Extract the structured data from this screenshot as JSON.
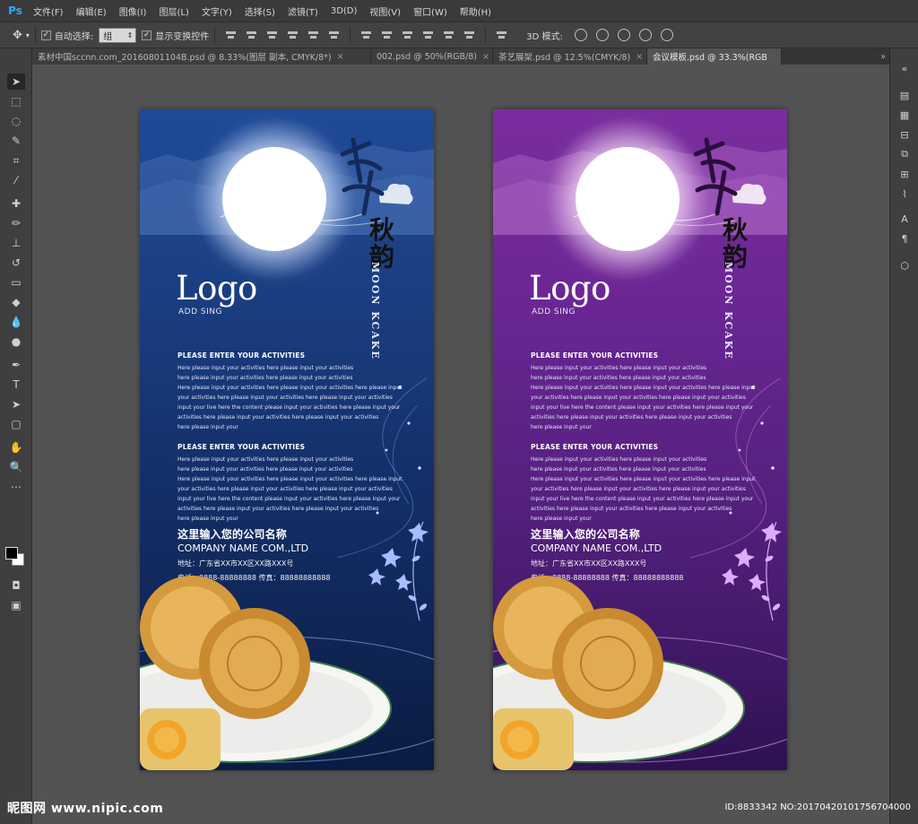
{
  "app": {
    "logo": "Ps"
  },
  "menu": [
    "文件(F)",
    "编辑(E)",
    "图像(I)",
    "图层(L)",
    "文字(Y)",
    "选择(S)",
    "滤镜(T)",
    "3D(D)",
    "视图(V)",
    "窗口(W)",
    "帮助(H)"
  ],
  "options": {
    "auto_select_label": "自动选择:",
    "auto_select_value": "组",
    "show_transform_label": "显示变换控件",
    "mode3d_label": "3D 模式:"
  },
  "tabs": [
    {
      "label": "素材中国sccnn.com_20160801104B.psd @ 8.33%(图层 副本, CMYK/8*)",
      "close": "×",
      "active": false
    },
    {
      "label": "002.psd @ 50%(RGB/8)",
      "close": "×",
      "active": false
    },
    {
      "label": "茶艺展架.psd @ 12.5%(CMYK/8)",
      "close": "×",
      "active": false
    },
    {
      "label": "会议模板.psd @ 33.3%(RGB",
      "close": "",
      "active": true
    }
  ],
  "banner": {
    "calligraphy_2": "秋韵",
    "moon_kcake": "MOON KCAKE",
    "logo": "Logo",
    "add_sing": "ADD SING",
    "activity_title": "PLEASE ENTER YOUR ACTIVITIES",
    "activity_lines": [
      "Here please input your activities here please input your activities",
      "here please input your activities here please input your activities",
      "Here please input your activities here please input your activities here please input",
      "your activities here please input your activities here please input your activities",
      "input your live here the content please input your activities here please input your",
      "activities here please input your activities here please input your activities",
      "here please input your"
    ],
    "activity_lines_2": [
      "Here please input your activities here please input your activities",
      "here please input your activities here please input your activities",
      "Here please input your activities here please input your activities here please input",
      "your activities here please input your activities here please input your activities",
      "input your live here the content please input your activities here please input your",
      "activities here please input your activities here please input your activities",
      "here please input your"
    ],
    "company_cn": "这里输入您的公司名称",
    "company_en": "COMPANY NAME COM.,LTD",
    "address": "地址：广东省XX市XX区XX路XXX号",
    "phone": "电话：8888-88888888  传真：88888888888"
  },
  "watermark": {
    "left": "昵图网 www.nipic.com",
    "right": "ID:8833342 NO:20170420101756704000"
  }
}
